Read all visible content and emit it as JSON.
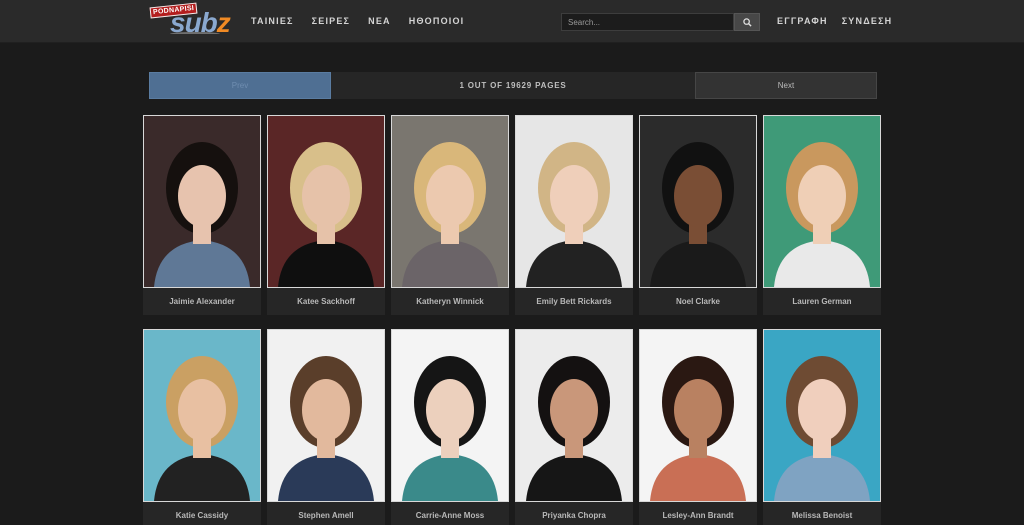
{
  "header": {
    "logo": {
      "badge": "PODNAPISI",
      "word_main": "sub",
      "word_accent": "z"
    },
    "nav": [
      {
        "label": "ΤΑΙΝΙΕΣ"
      },
      {
        "label": "ΣΕΙΡΕΣ"
      },
      {
        "label": "ΝΕΑ"
      },
      {
        "label": "ΗΘΟΠΟΙΟΙ"
      }
    ],
    "search": {
      "placeholder": "Search..."
    },
    "auth": {
      "register": "ΕΓΓΡΑΦΗ",
      "login": "ΣΥΝΔΕΣΗ"
    }
  },
  "pagination": {
    "prev_label": "Prev",
    "info": "1 OUT OF 19629 PAGES",
    "next_label": "Next"
  },
  "actors": [
    {
      "name": "Jaimie Alexander",
      "bg": "#3a2a2a",
      "hair": "#15100e",
      "skin": "#e7c3ae",
      "cloth": "#5f7896"
    },
    {
      "name": "Katee Sackhoff",
      "bg": "#5a2626",
      "hair": "#d8bf8a",
      "skin": "#e6c2a9",
      "cloth": "#0f0f0f"
    },
    {
      "name": "Katheryn Winnick",
      "bg": "#7a766f",
      "hair": "#d9b77a",
      "skin": "#ecc9af",
      "cloth": "#6b6468"
    },
    {
      "name": "Emily Bett Rickards",
      "bg": "#e6e6e6",
      "hair": "#d1b586",
      "skin": "#efcfba",
      "cloth": "#222222"
    },
    {
      "name": "Noel Clarke",
      "bg": "#2b2b2b",
      "hair": "#111111",
      "skin": "#7a4e35",
      "cloth": "#1a1a1a"
    },
    {
      "name": "Lauren German",
      "bg": "#3f9a78",
      "hair": "#c9985e",
      "skin": "#efcfb6",
      "cloth": "#e9e9e9"
    },
    {
      "name": "Katie Cassidy",
      "bg": "#6ab7c9",
      "hair": "#caa063",
      "skin": "#e8c0a2",
      "cloth": "#222222"
    },
    {
      "name": "Stephen Amell",
      "bg": "#f1f1f1",
      "hair": "#5a3e2a",
      "skin": "#e2b99d",
      "cloth": "#2a3a58"
    },
    {
      "name": "Carrie-Anne Moss",
      "bg": "#f4f4f4",
      "hair": "#151515",
      "skin": "#ecd0bd",
      "cloth": "#3a8a8a"
    },
    {
      "name": "Priyanka Chopra",
      "bg": "#ececec",
      "hair": "#141111",
      "skin": "#c9977a",
      "cloth": "#161616"
    },
    {
      "name": "Lesley-Ann Brandt",
      "bg": "#f4f4f4",
      "hair": "#2a1812",
      "skin": "#b98161",
      "cloth": "#c96f55"
    },
    {
      "name": "Melissa Benoist",
      "bg": "#3aa6c4",
      "hair": "#6e4b33",
      "skin": "#f0cfbd",
      "cloth": "#7fa3c2"
    }
  ]
}
